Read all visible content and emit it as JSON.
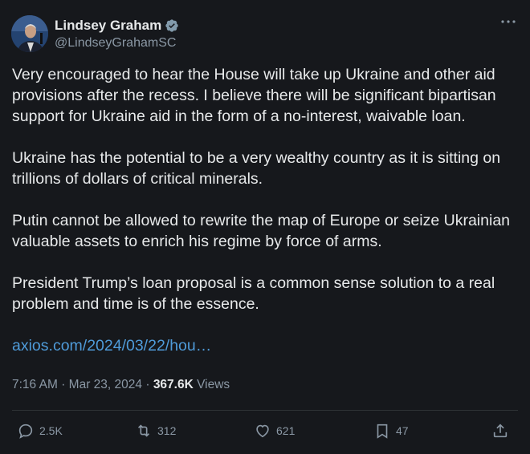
{
  "author": {
    "display_name": "Lindsey Graham",
    "handle": "@LindseyGrahamSC",
    "verified": true
  },
  "icons": {
    "more": "more-icon",
    "verified": "verified-badge-icon"
  },
  "tweet": {
    "paragraphs": [
      "Very encouraged to hear the House will take up Ukraine and other aid provisions after the recess. I believe there will be significant bipartisan support for Ukraine aid in the form of a no-interest, waivable loan.",
      "Ukraine has the potential to be a very wealthy country as it is sitting on trillions of dollars of critical minerals.",
      "Putin cannot be allowed to rewrite the map of Europe or seize Ukrainian valuable assets to enrich his regime by force of arms.",
      "President Trump’s loan proposal is a common sense solution to a real problem and time is of the essence."
    ],
    "link": "axios.com/2024/03/22/hou…"
  },
  "meta": {
    "time": "7:16 AM",
    "separator": "·",
    "date": "Mar 23, 2024",
    "views_count": "367.6K",
    "views_label": "Views"
  },
  "actions": {
    "replies": "2.5K",
    "reposts": "312",
    "likes": "621",
    "bookmarks": "47"
  },
  "colors": {
    "background": "#16181c",
    "text": "#e7e9ea",
    "secondary": "#8b98a5",
    "link": "#4f9bd9",
    "verified": "#829aab"
  }
}
